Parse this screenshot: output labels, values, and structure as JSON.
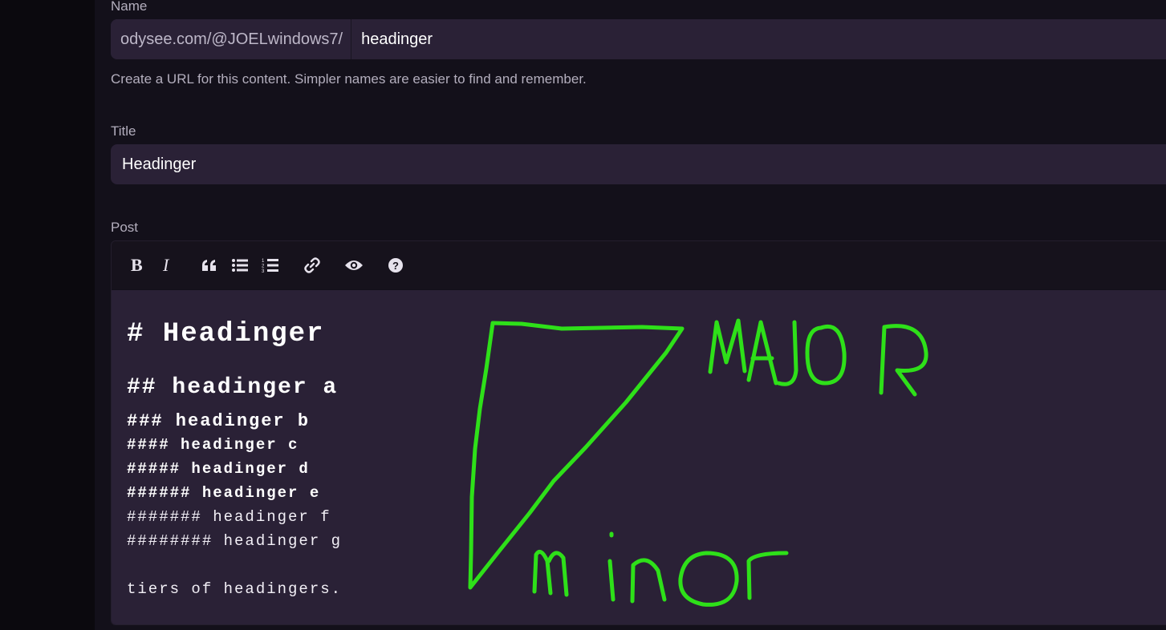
{
  "name_field": {
    "label": "Name",
    "prefix": "odysee.com/@JOELwindows7/",
    "value": "headinger",
    "helper": "Create a URL for this content. Simpler names are easier to find and remember."
  },
  "title_field": {
    "label": "Title",
    "value": "Headinger"
  },
  "post": {
    "label": "Post",
    "toolbar": [
      {
        "name": "bold-icon"
      },
      {
        "name": "italic-icon"
      },
      {
        "name": "quote-icon"
      },
      {
        "name": "unordered-list-icon"
      },
      {
        "name": "ordered-list-icon"
      },
      {
        "name": "link-icon"
      },
      {
        "name": "preview-eye-icon"
      },
      {
        "name": "help-icon"
      }
    ],
    "lines": {
      "h1": "# Headinger",
      "h2": "## headinger a",
      "h3": "### headinger b",
      "h4": "#### headinger c",
      "h5": "##### headinger d",
      "h6": "###### headinger e",
      "h7": "####### headinger f",
      "h8": "######## headinger g",
      "p1": "tiers of headingers."
    }
  },
  "annotation": {
    "color": "#2ee019",
    "major_text": "MAJOR",
    "minor_text": "minor"
  }
}
